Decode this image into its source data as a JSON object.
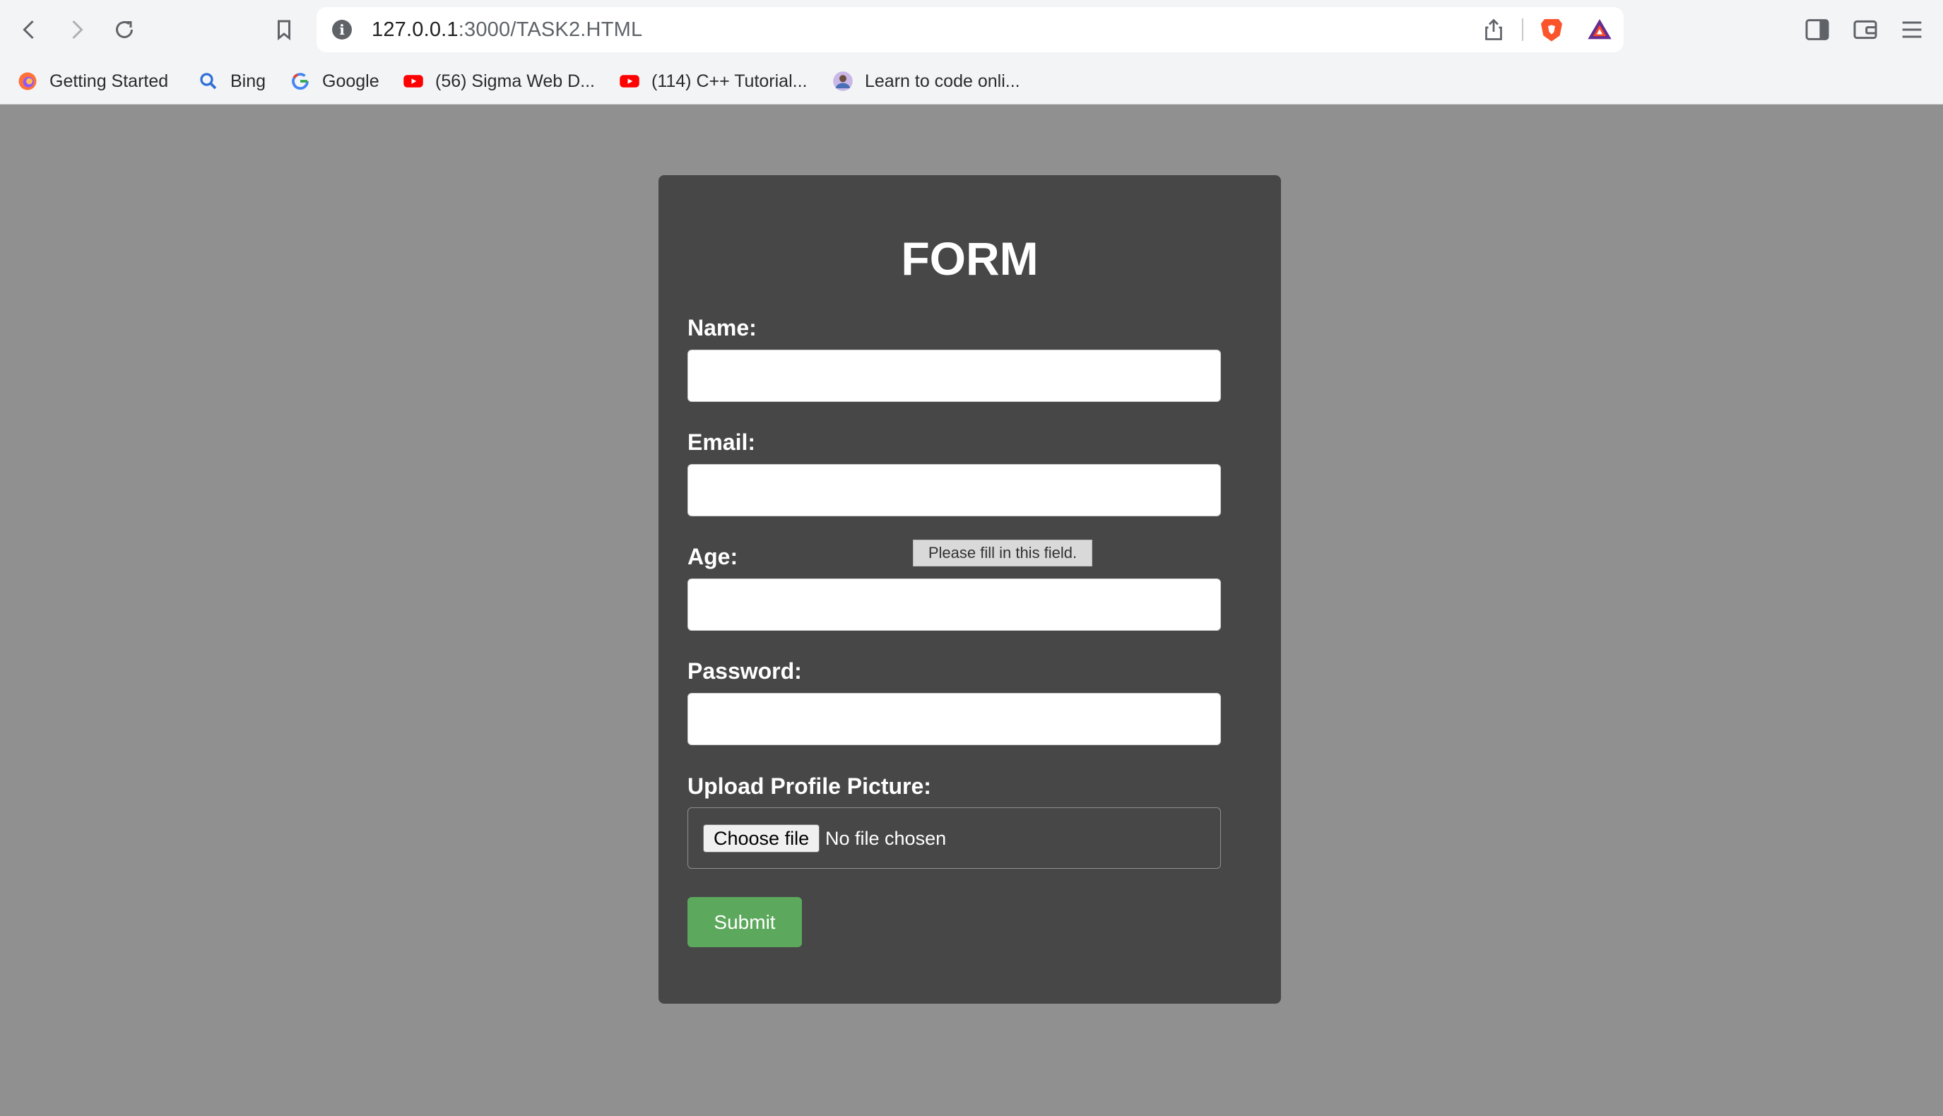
{
  "browser": {
    "url_host": "127.0.0.1",
    "url_path": ":3000/TASK2.HTML",
    "bookmarks": [
      {
        "label": "Getting Started",
        "icon": "firefox-icon"
      },
      {
        "label": "Bing",
        "icon": "bing-search-icon"
      },
      {
        "label": "Google",
        "icon": "google-icon"
      },
      {
        "label": "(56) Sigma Web D...",
        "icon": "youtube-icon"
      },
      {
        "label": "(114) C++ Tutorial...",
        "icon": "youtube-icon"
      },
      {
        "label": "Learn to code onli...",
        "icon": "avatar-icon"
      }
    ]
  },
  "form": {
    "title": "FORM",
    "name_label": "Name:",
    "email_label": "Email:",
    "age_label": "Age:",
    "password_label": "Password:",
    "upload_label": "Upload Profile Picture:",
    "choose_file_label": "Choose file",
    "file_status": "No file chosen",
    "submit_label": "Submit",
    "validation_tooltip": "Please fill in this field."
  },
  "colors": {
    "page_background": "#909090",
    "card_background": "#474747",
    "submit_green": "#5ca85c"
  }
}
